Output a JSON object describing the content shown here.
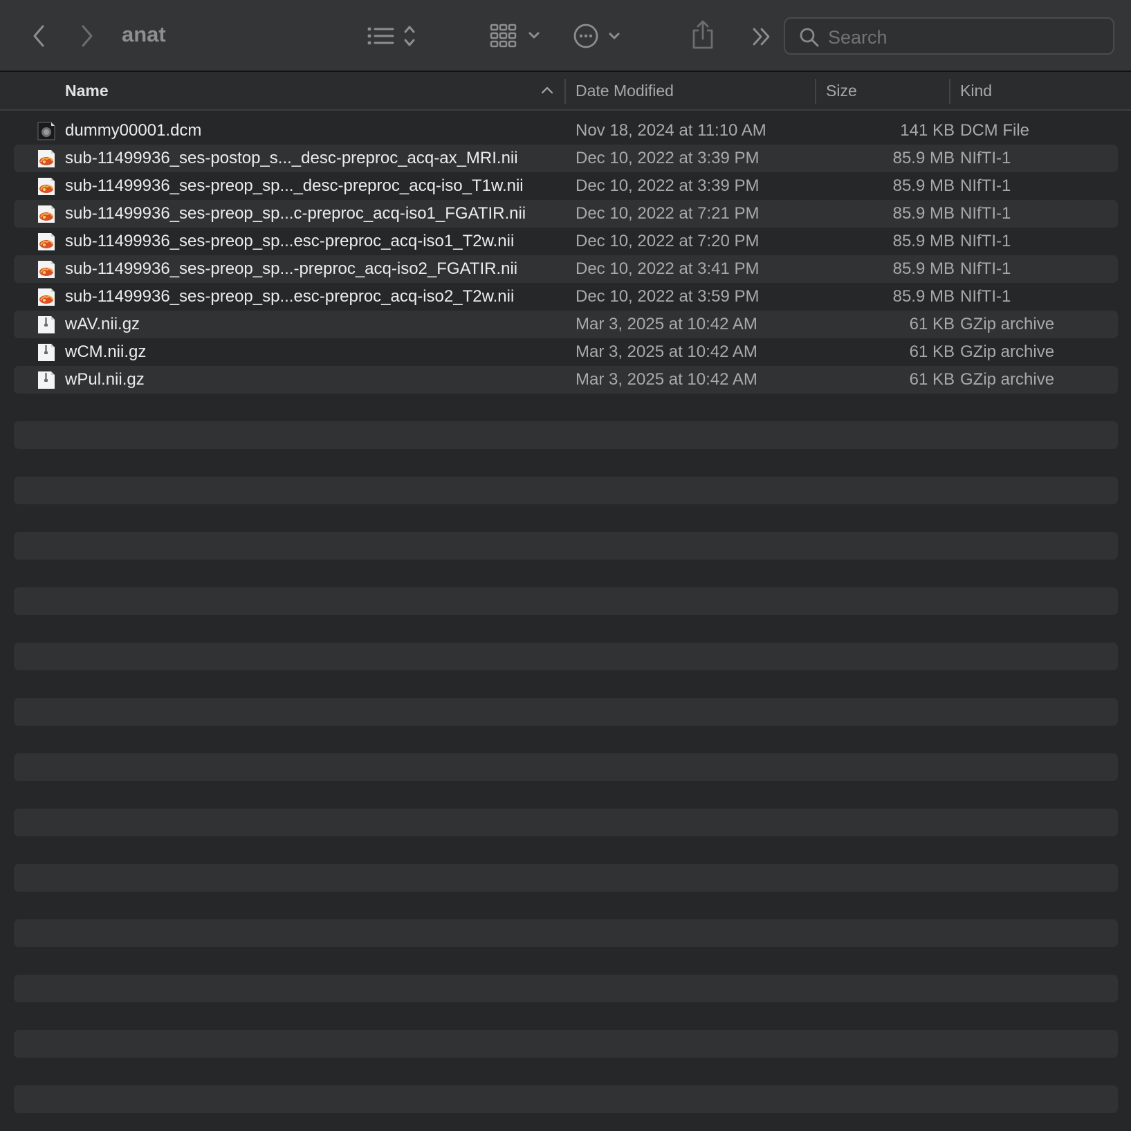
{
  "window": {
    "title": "anat"
  },
  "toolbar": {
    "back_icon": "chevron-left-icon",
    "forward_icon": "chevron-right-icon",
    "list_view_icon": "list-icon",
    "grid_group_icon": "grid-icon",
    "action_icon": "ellipsis-circle-icon",
    "share_icon": "share-icon",
    "overflow_icon": "double-chevron-icon",
    "search": {
      "placeholder": "Search",
      "value": ""
    }
  },
  "columns": {
    "name": "Name",
    "date": "Date Modified",
    "size": "Size",
    "kind": "Kind"
  },
  "files": [
    {
      "name": "dummy00001.dcm",
      "date": "Nov 18, 2024 at 11:10 AM",
      "size": "141 KB",
      "kind": "DCM File",
      "icon": "dicom-file-icon"
    },
    {
      "name": "sub-11499936_ses-postop_s..._desc-preproc_acq-ax_MRI.nii",
      "date": "Dec 10, 2022 at 3:39 PM",
      "size": "85.9 MB",
      "kind": "NIfTI-1",
      "icon": "nifti-file-icon"
    },
    {
      "name": "sub-11499936_ses-preop_sp..._desc-preproc_acq-iso_T1w.nii",
      "date": "Dec 10, 2022 at 3:39 PM",
      "size": "85.9 MB",
      "kind": "NIfTI-1",
      "icon": "nifti-file-icon"
    },
    {
      "name": "sub-11499936_ses-preop_sp...c-preproc_acq-iso1_FGATIR.nii",
      "date": "Dec 10, 2022 at 7:21 PM",
      "size": "85.9 MB",
      "kind": "NIfTI-1",
      "icon": "nifti-file-icon"
    },
    {
      "name": "sub-11499936_ses-preop_sp...esc-preproc_acq-iso1_T2w.nii",
      "date": "Dec 10, 2022 at 7:20 PM",
      "size": "85.9 MB",
      "kind": "NIfTI-1",
      "icon": "nifti-file-icon"
    },
    {
      "name": "sub-11499936_ses-preop_sp...-preproc_acq-iso2_FGATIR.nii",
      "date": "Dec 10, 2022 at 3:41 PM",
      "size": "85.9 MB",
      "kind": "NIfTI-1",
      "icon": "nifti-file-icon"
    },
    {
      "name": "sub-11499936_ses-preop_sp...esc-preproc_acq-iso2_T2w.nii",
      "date": "Dec 10, 2022 at 3:59 PM",
      "size": "85.9 MB",
      "kind": "NIfTI-1",
      "icon": "nifti-file-icon"
    },
    {
      "name": "wAV.nii.gz",
      "date": "Mar 3, 2025 at 10:42 AM",
      "size": "61 KB",
      "kind": "GZip archive",
      "icon": "gzip-archive-icon"
    },
    {
      "name": "wCM.nii.gz",
      "date": "Mar 3, 2025 at 10:42 AM",
      "size": "61 KB",
      "kind": "GZip archive",
      "icon": "gzip-archive-icon"
    },
    {
      "name": "wPul.nii.gz",
      "date": "Mar 3, 2025 at 10:42 AM",
      "size": "61 KB",
      "kind": "GZip archive",
      "icon": "gzip-archive-icon"
    }
  ],
  "colors": {
    "background": "#262728",
    "toolbar": "#343536",
    "stripe": "#313233",
    "text_primary": "#ececee",
    "text_secondary": "#a9a9ab"
  }
}
